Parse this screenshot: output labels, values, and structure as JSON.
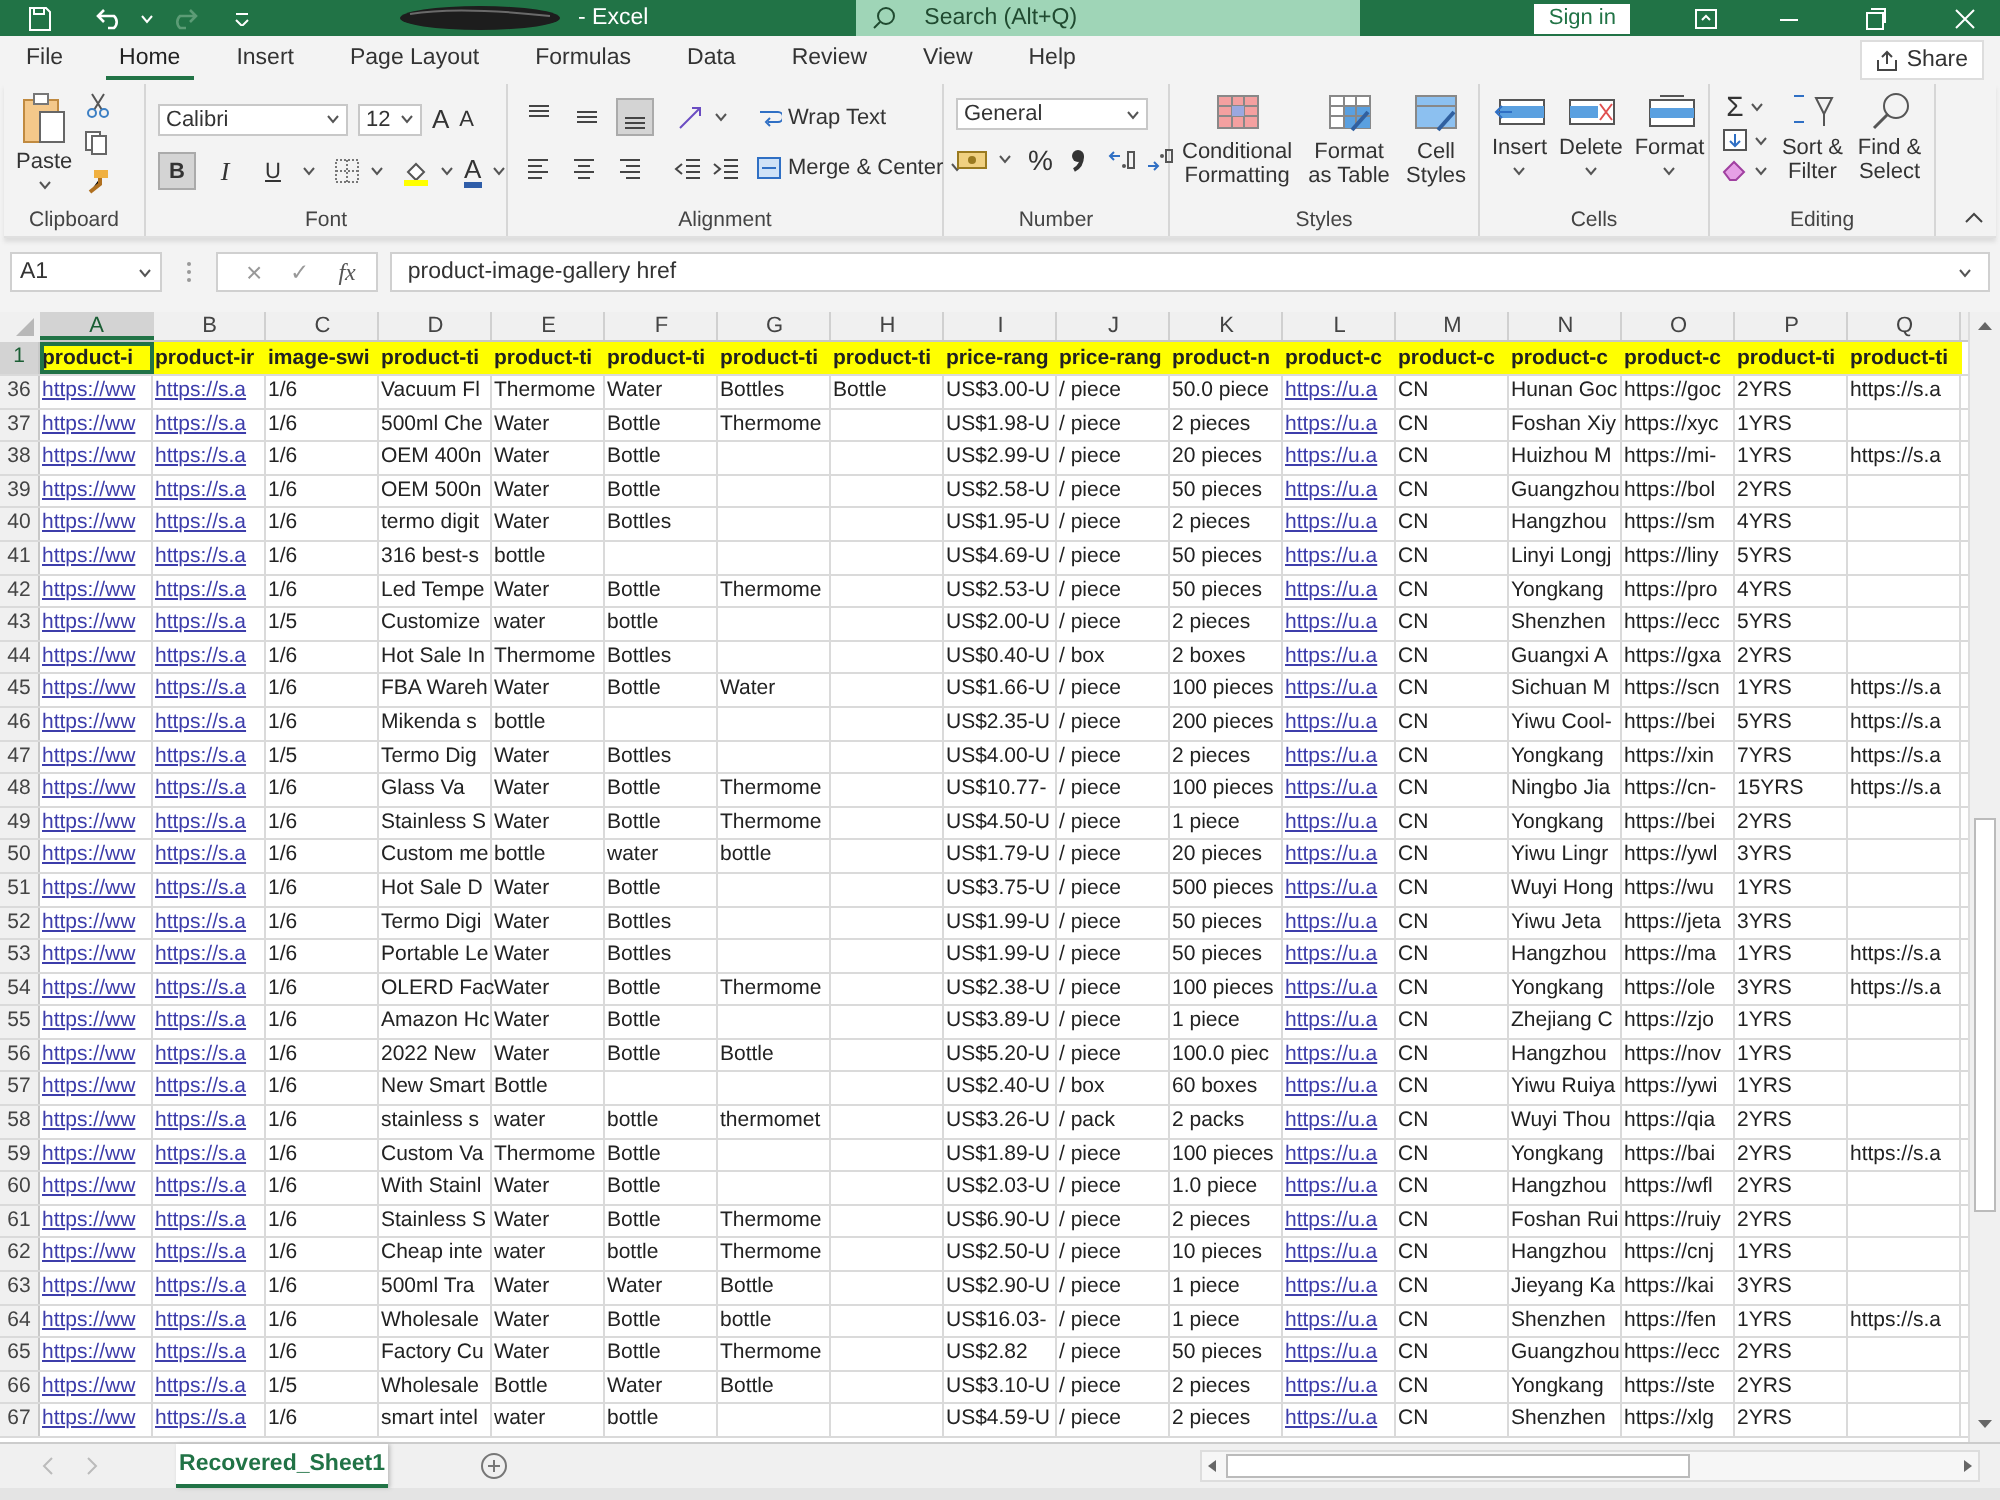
{
  "title_bar": {
    "title": "- Excel",
    "search_placeholder": "Search (Alt+Q)",
    "sign_in": "Sign in"
  },
  "ribbon_tabs": [
    {
      "label": "File",
      "selected": false
    },
    {
      "label": "Home",
      "selected": true
    },
    {
      "label": "Insert",
      "selected": false
    },
    {
      "label": "Page Layout",
      "selected": false
    },
    {
      "label": "Formulas",
      "selected": false
    },
    {
      "label": "Data",
      "selected": false
    },
    {
      "label": "Review",
      "selected": false
    },
    {
      "label": "View",
      "selected": false
    },
    {
      "label": "Help",
      "selected": false
    }
  ],
  "share": "Share",
  "ribbon": {
    "clipboard": {
      "paste": "Paste",
      "label": "Clipboard"
    },
    "font": {
      "name": "Calibri",
      "size": "12",
      "grow": "A",
      "shrink": "A",
      "bold": "B",
      "bold_on": true,
      "italic": "I",
      "underline": "U",
      "font_color_label": "A",
      "label": "Font"
    },
    "alignment": {
      "vertical": [
        {
          "selected": false
        },
        {
          "selected": false
        },
        {
          "selected": true
        }
      ],
      "wrap": "Wrap Text",
      "merge": "Merge & Center",
      "label": "Alignment"
    },
    "number": {
      "format": "General",
      "percent": "%",
      "label": "Number"
    },
    "styles": {
      "items": [
        "Conditional Formatting",
        "Format as Table",
        "Cell Styles"
      ],
      "label": "Styles"
    },
    "cells": {
      "items": [
        "Insert",
        "Delete",
        "Format"
      ],
      "label": "Cells"
    },
    "editing": {
      "autosum": "Σ",
      "items": [
        "Sort & Filter",
        "Find & Select"
      ],
      "label": "Editing"
    }
  },
  "formula_bar": {
    "name_box": "A1",
    "cancel": "×",
    "enter": "✓",
    "fx": "fx",
    "value": "product-image-gallery href"
  },
  "sheet": {
    "columns": [
      {
        "letter": "A",
        "header": "product-i",
        "kind": "link",
        "selected": true
      },
      {
        "letter": "B",
        "header": "product-ir",
        "kind": "link",
        "selected": false
      },
      {
        "letter": "C",
        "header": "image-swi",
        "kind": "text",
        "selected": false
      },
      {
        "letter": "D",
        "header": "product-ti",
        "kind": "text",
        "selected": false
      },
      {
        "letter": "E",
        "header": "product-ti",
        "kind": "text",
        "selected": false
      },
      {
        "letter": "F",
        "header": "product-ti",
        "kind": "text",
        "selected": false
      },
      {
        "letter": "G",
        "header": "product-ti",
        "kind": "text",
        "selected": false
      },
      {
        "letter": "H",
        "header": "product-ti",
        "kind": "text",
        "selected": false
      },
      {
        "letter": "I",
        "header": "price-rang",
        "kind": "text",
        "selected": false
      },
      {
        "letter": "J",
        "header": "price-rang",
        "kind": "text",
        "selected": false
      },
      {
        "letter": "K",
        "header": "product-n",
        "kind": "text",
        "selected": false
      },
      {
        "letter": "L",
        "header": "product-c",
        "kind": "link",
        "selected": false
      },
      {
        "letter": "M",
        "header": "product-c",
        "kind": "text",
        "selected": false
      },
      {
        "letter": "N",
        "header": "product-c",
        "kind": "text",
        "selected": false
      },
      {
        "letter": "O",
        "header": "product-c",
        "kind": "text",
        "selected": false
      },
      {
        "letter": "P",
        "header": "product-ti",
        "kind": "text",
        "selected": false
      },
      {
        "letter": "Q",
        "header": "product-ti",
        "kind": "text",
        "selected": false
      }
    ],
    "header_row": "1",
    "rows": [
      {
        "row": "36",
        "cells": [
          "https://ww",
          "https://s.a",
          "1/6",
          "Vacuum Fl",
          "Thermome",
          "Water",
          "Bottles",
          "Bottle",
          "US$3.00-U",
          "/ piece",
          "50.0 piece",
          "https://u.a",
          "CN",
          "Hunan Goc",
          "https://goc",
          "2YRS",
          "https://s.a"
        ]
      },
      {
        "row": "37",
        "cells": [
          "https://ww",
          "https://s.a",
          "1/6",
          "500ml Che",
          "Water",
          "Bottle",
          "Thermome",
          null,
          "US$1.98-U",
          "/ piece",
          "2 pieces",
          "https://u.a",
          "CN",
          "Foshan Xiy",
          "https://xyc",
          "1YRS",
          null
        ]
      },
      {
        "row": "38",
        "cells": [
          "https://ww",
          "https://s.a",
          "1/6",
          "OEM 400n",
          "Water",
          "Bottle",
          null,
          null,
          "US$2.99-U",
          "/ piece",
          "20 pieces",
          "https://u.a",
          "CN",
          "Huizhou M",
          "https://mi-",
          "1YRS",
          "https://s.a"
        ]
      },
      {
        "row": "39",
        "cells": [
          "https://ww",
          "https://s.a",
          "1/6",
          "OEM 500n",
          "Water",
          "Bottle",
          null,
          null,
          "US$2.58-U",
          "/ piece",
          "50 pieces",
          "https://u.a",
          "CN",
          "Guangzhou",
          "https://bol",
          "2YRS",
          null
        ]
      },
      {
        "row": "40",
        "cells": [
          "https://ww",
          "https://s.a",
          "1/6",
          "termo digit",
          "Water",
          "Bottles",
          null,
          null,
          "US$1.95-U",
          "/ piece",
          "2 pieces",
          "https://u.a",
          "CN",
          "Hangzhou",
          "https://sm",
          "4YRS",
          null
        ]
      },
      {
        "row": "41",
        "cells": [
          "https://ww",
          "https://s.a",
          "1/6",
          "316 best-s",
          "bottle",
          null,
          null,
          null,
          "US$4.69-U",
          "/ piece",
          "50 pieces",
          "https://u.a",
          "CN",
          "Linyi Longj",
          "https://liny",
          "5YRS",
          null
        ]
      },
      {
        "row": "42",
        "cells": [
          "https://ww",
          "https://s.a",
          "1/6",
          "Led Tempe",
          "Water",
          "Bottle",
          "Thermome",
          null,
          "US$2.53-U",
          "/ piece",
          "50 pieces",
          "https://u.a",
          "CN",
          "Yongkang",
          "https://pro",
          "4YRS",
          null
        ]
      },
      {
        "row": "43",
        "cells": [
          "https://ww",
          "https://s.a",
          "1/5",
          "Customize",
          "water",
          "bottle",
          null,
          null,
          "US$2.00-U",
          "/ piece",
          "2 pieces",
          "https://u.a",
          "CN",
          "Shenzhen",
          "https://ecc",
          "5YRS",
          null
        ]
      },
      {
        "row": "44",
        "cells": [
          "https://ww",
          "https://s.a",
          "1/6",
          "Hot Sale In",
          "Thermome",
          "Bottles",
          null,
          null,
          "US$0.40-U",
          "/ box",
          "2 boxes",
          "https://u.a",
          "CN",
          "Guangxi A",
          "https://gxa",
          "2YRS",
          null
        ]
      },
      {
        "row": "45",
        "cells": [
          "https://ww",
          "https://s.a",
          "1/6",
          "FBA Wareh",
          "Water",
          "Bottle",
          "Water",
          null,
          "US$1.66-U",
          "/ piece",
          "100 pieces",
          "https://u.a",
          "CN",
          "Sichuan M",
          "https://scn",
          "1YRS",
          "https://s.a"
        ]
      },
      {
        "row": "46",
        "cells": [
          "https://ww",
          "https://s.a",
          "1/6",
          "Mikenda s",
          "bottle",
          null,
          null,
          null,
          "US$2.35-U",
          "/ piece",
          "200 pieces",
          "https://u.a",
          "CN",
          "Yiwu Cool-",
          "https://bei",
          "5YRS",
          "https://s.a"
        ]
      },
      {
        "row": "47",
        "cells": [
          "https://ww",
          "https://s.a",
          "1/5",
          "Termo Dig",
          "Water",
          "Bottles",
          null,
          null,
          "US$4.00-U",
          "/ piece",
          "2 pieces",
          "https://u.a",
          "CN",
          "Yongkang",
          "https://xin",
          "7YRS",
          "https://s.a"
        ]
      },
      {
        "row": "48",
        "cells": [
          "https://ww",
          "https://s.a",
          "1/6",
          "Glass   Va",
          "Water",
          "Bottle",
          "Thermome",
          null,
          "US$10.77-",
          "/ piece",
          "100 pieces",
          "https://u.a",
          "CN",
          "Ningbo Jia",
          "https://cn-",
          "15YRS",
          "https://s.a"
        ]
      },
      {
        "row": "49",
        "cells": [
          "https://ww",
          "https://s.a",
          "1/6",
          "Stainless S",
          "Water",
          "Bottle",
          "Thermome",
          null,
          "US$4.50-U",
          "/ piece",
          "1 piece",
          "https://u.a",
          "CN",
          "Yongkang",
          "https://bei",
          "2YRS",
          null
        ]
      },
      {
        "row": "50",
        "cells": [
          "https://ww",
          "https://s.a",
          "1/6",
          "Custom me",
          "bottle",
          "water",
          "bottle",
          null,
          "US$1.79-U",
          "/ piece",
          "20 pieces",
          "https://u.a",
          "CN",
          "Yiwu Lingr",
          "https://ywl",
          "3YRS",
          null
        ]
      },
      {
        "row": "51",
        "cells": [
          "https://ww",
          "https://s.a",
          "1/6",
          "Hot Sale D",
          "Water",
          "Bottle",
          null,
          null,
          "US$3.75-U",
          "/ piece",
          "500 pieces",
          "https://u.a",
          "CN",
          "Wuyi Hong",
          "https://wu",
          "1YRS",
          null
        ]
      },
      {
        "row": "52",
        "cells": [
          "https://ww",
          "https://s.a",
          "1/6",
          "Termo Digi",
          "Water",
          "Bottles",
          null,
          null,
          "US$1.99-U",
          "/ piece",
          "50 pieces",
          "https://u.a",
          "CN",
          "Yiwu Jeta",
          "https://jeta",
          "3YRS",
          null
        ]
      },
      {
        "row": "53",
        "cells": [
          "https://ww",
          "https://s.a",
          "1/6",
          "Portable Le",
          "Water",
          "Bottles",
          null,
          null,
          "US$1.99-U",
          "/ piece",
          "50 pieces",
          "https://u.a",
          "CN",
          "Hangzhou",
          "https://ma",
          "1YRS",
          "https://s.a"
        ]
      },
      {
        "row": "54",
        "cells": [
          "https://ww",
          "https://s.a",
          "1/6",
          "OLERD Fac",
          "Water",
          "Bottle",
          "Thermome",
          null,
          "US$2.38-U",
          "/ piece",
          "100 pieces",
          "https://u.a",
          "CN",
          "Yongkang",
          "https://ole",
          "3YRS",
          "https://s.a"
        ]
      },
      {
        "row": "55",
        "cells": [
          "https://ww",
          "https://s.a",
          "1/6",
          "Amazon Hc",
          "Water",
          "Bottle",
          null,
          null,
          "US$3.89-U",
          "/ piece",
          "1 piece",
          "https://u.a",
          "CN",
          "Zhejiang C",
          "https://zjo",
          "1YRS",
          null
        ]
      },
      {
        "row": "56",
        "cells": [
          "https://ww",
          "https://s.a",
          "1/6",
          "2022 New",
          "Water",
          "Bottle",
          "Bottle",
          null,
          "US$5.20-U",
          "/ piece",
          "100.0 piec",
          "https://u.a",
          "CN",
          "Hangzhou",
          "https://nov",
          "1YRS",
          null
        ]
      },
      {
        "row": "57",
        "cells": [
          "https://ww",
          "https://s.a",
          "1/6",
          "New Smart",
          "Bottle",
          null,
          null,
          null,
          "US$2.40-U",
          "/ box",
          "60 boxes",
          "https://u.a",
          "CN",
          "Yiwu Ruiya",
          "https://ywi",
          "1YRS",
          null
        ]
      },
      {
        "row": "58",
        "cells": [
          "https://ww",
          "https://s.a",
          "1/6",
          "stainless s",
          "water",
          "bottle",
          "thermomet",
          null,
          "US$3.26-U",
          "/ pack",
          "2 packs",
          "https://u.a",
          "CN",
          "Wuyi Thou",
          "https://qia",
          "2YRS",
          null
        ]
      },
      {
        "row": "59",
        "cells": [
          "https://ww",
          "https://s.a",
          "1/6",
          "Custom Va",
          "Thermome",
          "Bottle",
          null,
          null,
          "US$1.89-U",
          "/ piece",
          "100 pieces",
          "https://u.a",
          "CN",
          "Yongkang",
          "https://bai",
          "2YRS",
          "https://s.a"
        ]
      },
      {
        "row": "60",
        "cells": [
          "https://ww",
          "https://s.a",
          "1/6",
          "With Stainl",
          "Water",
          "Bottle",
          null,
          null,
          "US$2.03-U",
          "/ piece",
          "1.0 piece",
          "https://u.a",
          "CN",
          "Hangzhou",
          "https://wfl",
          "2YRS",
          null
        ]
      },
      {
        "row": "61",
        "cells": [
          "https://ww",
          "https://s.a",
          "1/6",
          "Stainless S",
          "Water",
          "Bottle",
          "Thermome",
          null,
          "US$6.90-U",
          "/ piece",
          "2 pieces",
          "https://u.a",
          "CN",
          "Foshan Rui",
          "https://ruiy",
          "2YRS",
          null
        ]
      },
      {
        "row": "62",
        "cells": [
          "https://ww",
          "https://s.a",
          "1/6",
          "Cheap inte",
          "water",
          "bottle",
          "Thermome",
          null,
          "US$2.50-U",
          "/ piece",
          "10 pieces",
          "https://u.a",
          "CN",
          "Hangzhou",
          "https://cnj",
          "1YRS",
          null
        ]
      },
      {
        "row": "63",
        "cells": [
          "https://ww",
          "https://s.a",
          "1/6",
          "500ml  Tra",
          "Water",
          "Water",
          "Bottle",
          null,
          "US$2.90-U",
          "/ piece",
          "1 piece",
          "https://u.a",
          "CN",
          "Jieyang Ka",
          "https://kai",
          "3YRS",
          null
        ]
      },
      {
        "row": "64",
        "cells": [
          "https://ww",
          "https://s.a",
          "1/6",
          "Wholesale",
          "Water",
          "Bottle",
          "bottle",
          null,
          "US$16.03-",
          "/ piece",
          "1 piece",
          "https://u.a",
          "CN",
          "Shenzhen",
          "https://fen",
          "1YRS",
          "https://s.a"
        ]
      },
      {
        "row": "65",
        "cells": [
          "https://ww",
          "https://s.a",
          "1/6",
          "Factory Cu",
          "Water",
          "Bottle",
          "Thermome",
          null,
          "US$2.82",
          "/ piece",
          "50 pieces",
          "https://u.a",
          "CN",
          "Guangzhou",
          "https://ecc",
          "2YRS",
          null
        ]
      },
      {
        "row": "66",
        "cells": [
          "https://ww",
          "https://s.a",
          "1/5",
          "Wholesale",
          "Bottle",
          "Water",
          "Bottle",
          null,
          "US$3.10-U",
          "/ piece",
          "2 pieces",
          "https://u.a",
          "CN",
          "Yongkang",
          "https://ste",
          "2YRS",
          null
        ]
      },
      {
        "row": "67",
        "cells": [
          "https://ww",
          "https://s.a",
          "1/6",
          "smart intel",
          "water",
          "bottle",
          null,
          null,
          "US$4.59-U",
          "/ piece",
          "2 pieces",
          "https://u.a",
          "CN",
          "Shenzhen",
          "https://xlg",
          "2YRS",
          null
        ]
      }
    ]
  },
  "sheet_tabs": [
    {
      "label": "Recovered_Sheet1",
      "selected": true
    }
  ]
}
